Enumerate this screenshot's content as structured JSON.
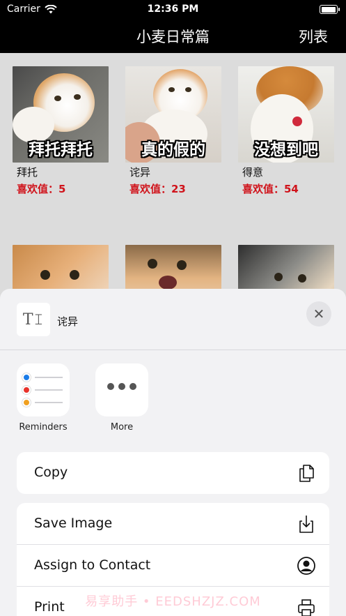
{
  "status_bar": {
    "carrier": "Carrier",
    "time": "12:36 PM"
  },
  "nav": {
    "title": "小麦日常篇",
    "right_button": "列表"
  },
  "grid": {
    "items": [
      {
        "caption": "拜托拜托",
        "name": "拜托",
        "likes": "喜欢值：5"
      },
      {
        "caption": "真的假的",
        "name": "诧异",
        "likes": "喜欢值：23"
      },
      {
        "caption": "没想到吧",
        "name": "得意",
        "likes": "喜欢值：54"
      },
      {
        "caption": "",
        "name": "",
        "likes": ""
      },
      {
        "caption": "",
        "name": "",
        "likes": ""
      },
      {
        "caption": "",
        "name": "",
        "likes": ""
      }
    ]
  },
  "share_sheet": {
    "preview_icon": "T𝙸",
    "preview_title": "诧异",
    "close_icon": "✕",
    "apps": [
      {
        "label": "Reminders",
        "icon": "reminders-icon"
      },
      {
        "label": "More",
        "icon": "more-icon"
      }
    ],
    "actions_group1": [
      {
        "label": "Copy",
        "icon": "copy-icon"
      }
    ],
    "actions_group2": [
      {
        "label": "Save Image",
        "icon": "save-image-icon"
      },
      {
        "label": "Assign to Contact",
        "icon": "contact-icon"
      },
      {
        "label": "Print",
        "icon": "print-icon"
      }
    ]
  },
  "watermark": "易享助手 • EEDSHZJZ.COM",
  "colors": {
    "likes": "#d0131b",
    "background": "#dcdcdc",
    "sheet": "#f2f2f4"
  }
}
